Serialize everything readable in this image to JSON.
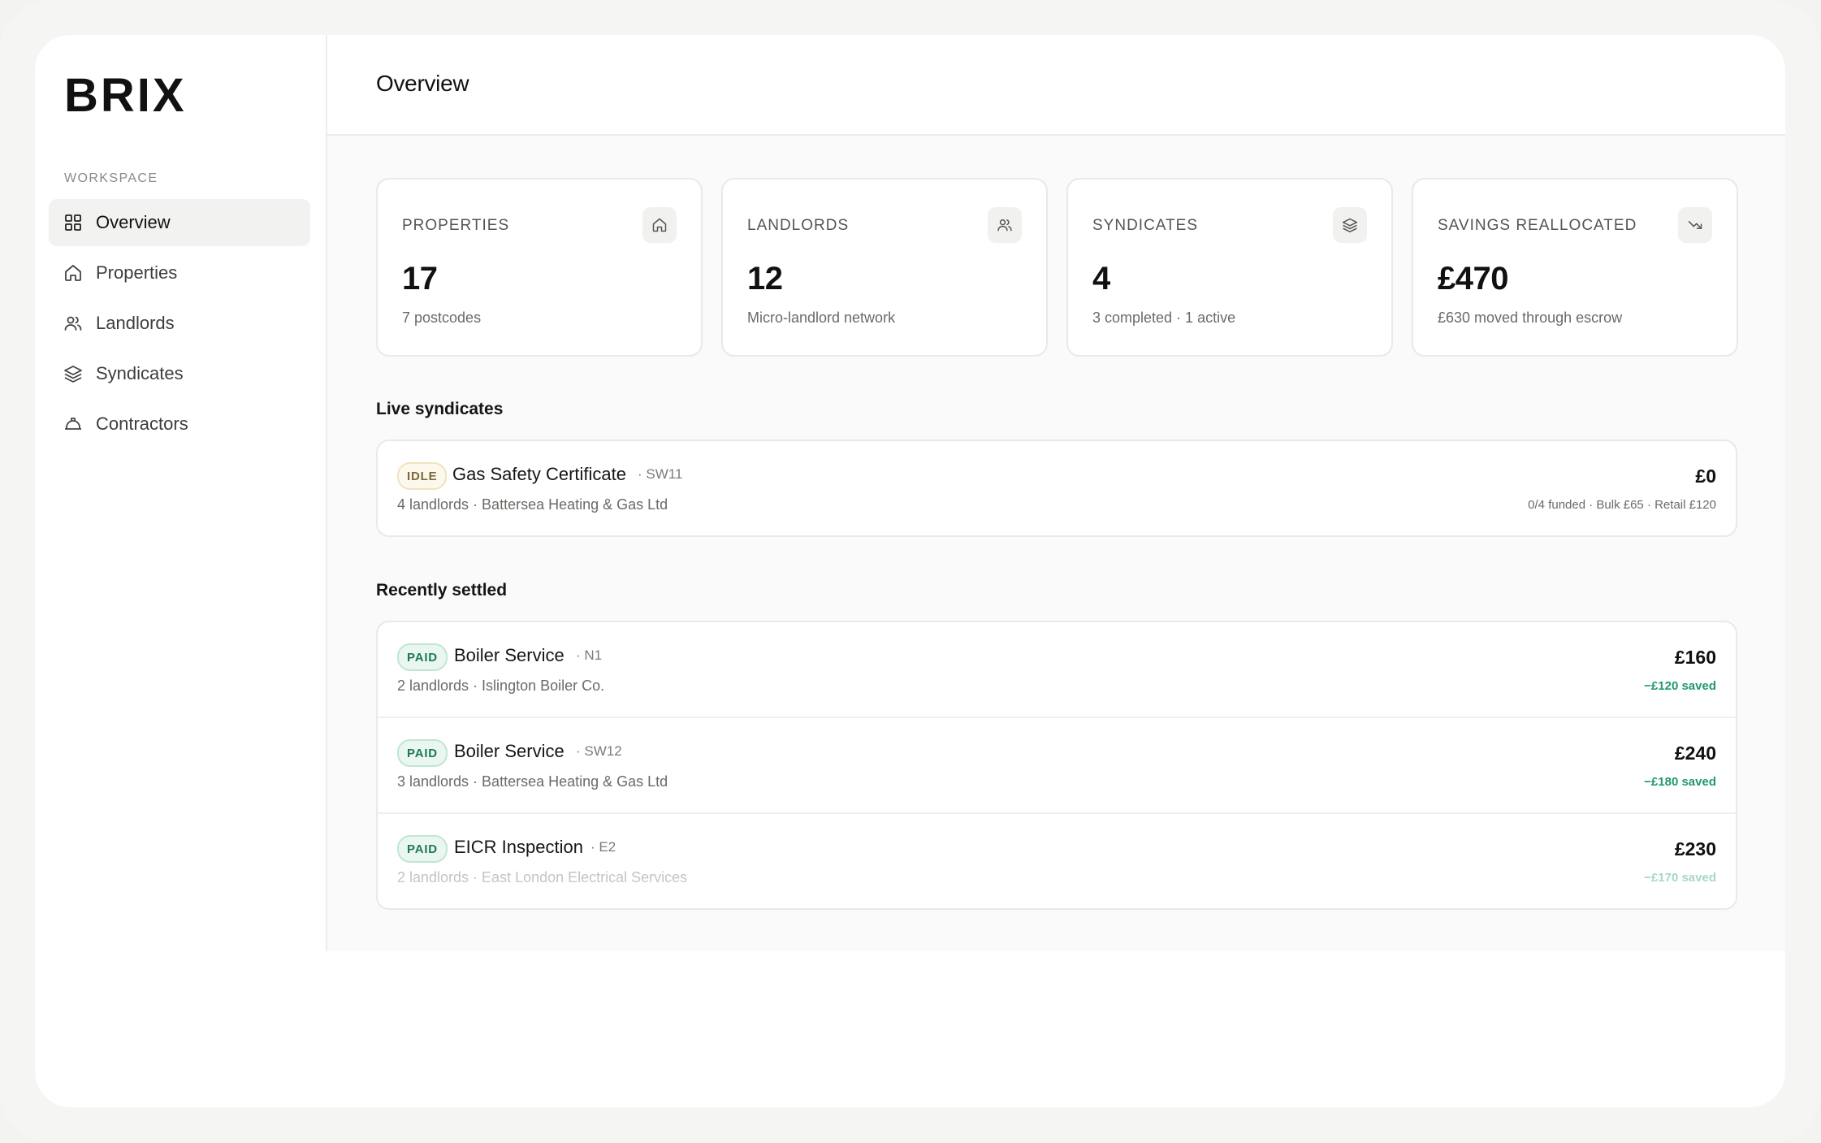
{
  "app": {
    "logo_text": "BRIX"
  },
  "sidebar": {
    "section_label": "WORKSPACE",
    "items": [
      {
        "label": "Overview",
        "icon": "grid-icon",
        "active": true
      },
      {
        "label": "Properties",
        "icon": "home-icon"
      },
      {
        "label": "Landlords",
        "icon": "users-icon"
      },
      {
        "label": "Syndicates",
        "icon": "layers-icon"
      },
      {
        "label": "Contractors",
        "icon": "hard-hat-icon"
      }
    ]
  },
  "header": {
    "title": "Overview"
  },
  "stats": [
    {
      "label": "PROPERTIES",
      "value": "17",
      "sub": "7 postcodes",
      "icon": "home-icon"
    },
    {
      "label": "LANDLORDS",
      "value": "12",
      "sub": "Micro-landlord network",
      "icon": "users-icon"
    },
    {
      "label": "SYNDICATES",
      "value": "4",
      "sub": "3 completed · 1 active",
      "icon": "layers-icon"
    },
    {
      "label": "SAVINGS REALLOCATED",
      "value": "£470",
      "sub": "£630 moved through escrow",
      "icon": "trending-down-icon"
    }
  ],
  "live": {
    "title": "Live syndicates",
    "items": [
      {
        "badge": "IDLE",
        "title": "Gas Safety Certificate",
        "code": "· SW11",
        "sub": "4 landlords · Battersea Heating & Gas Ltd",
        "amount": "£0",
        "meta": "0/4 funded · Bulk £65 · Retail £120"
      }
    ]
  },
  "settled": {
    "title": "Recently settled",
    "items": [
      {
        "badge": "PAID",
        "title": "Boiler Service",
        "code": "· N1",
        "sub": "2 landlords · Islington Boiler Co.",
        "amount": "£160",
        "saved": "−£120 saved"
      },
      {
        "badge": "PAID",
        "title": "Boiler Service",
        "code": "· SW12",
        "sub": "3 landlords · Battersea Heating & Gas Ltd",
        "amount": "£240",
        "saved": "−£180 saved"
      },
      {
        "badge": "PAID",
        "title": "EICR Inspection",
        "code": "· E2",
        "sub": "2 landlords · East London Electrical Services",
        "amount": "£230",
        "saved": "−£170 saved"
      }
    ]
  },
  "colors": {
    "accent_green": "#1f9a6a",
    "idle_amber": "#7a6a3c",
    "border": "#e9e9e7"
  }
}
